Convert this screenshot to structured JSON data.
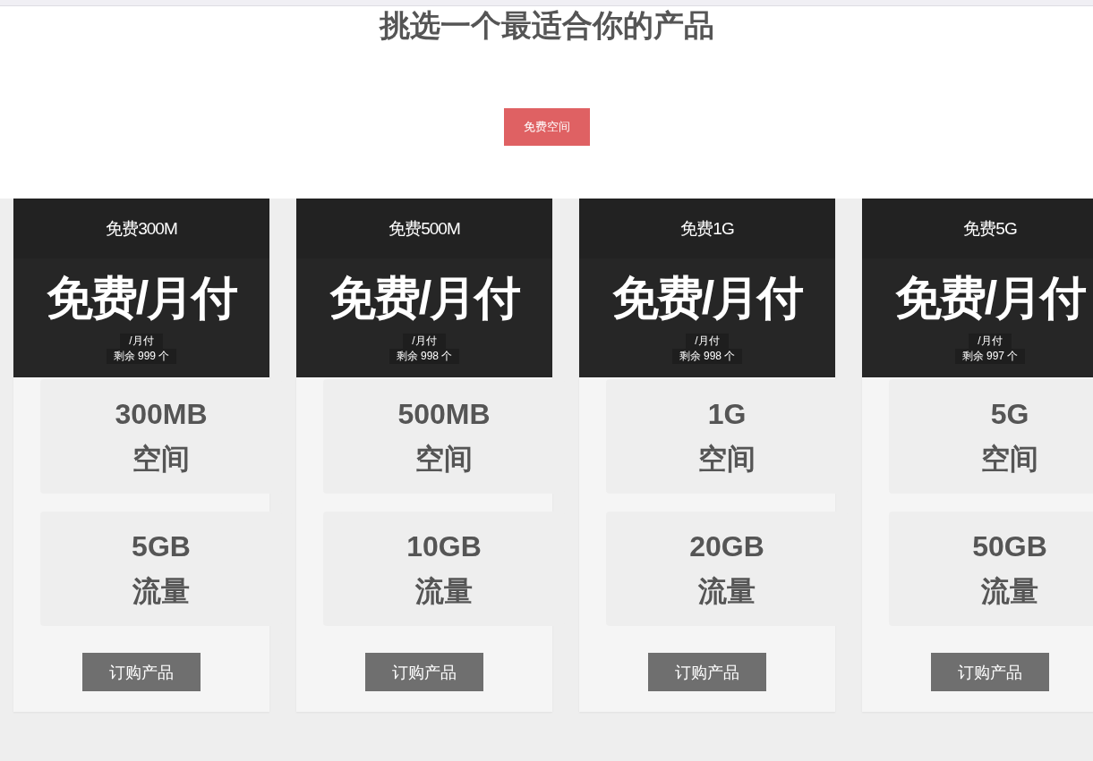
{
  "heading": "挑选一个最适合你的产品",
  "filter": {
    "label": "免费空间",
    "selected": true
  },
  "plans": [
    {
      "name": "免费300M",
      "price": "免费/月付",
      "period": "/月付",
      "stock": "剩余 999 个",
      "features": [
        {
          "value": "300MB",
          "label": "空间"
        },
        {
          "value": "5GB",
          "label": "流量"
        }
      ],
      "button": "订购产品"
    },
    {
      "name": "免费500M",
      "price": "免费/月付",
      "period": "/月付",
      "stock": "剩余 998 个",
      "features": [
        {
          "value": "500MB",
          "label": "空间"
        },
        {
          "value": "10GB",
          "label": "流量"
        }
      ],
      "button": "订购产品"
    },
    {
      "name": "免费1G",
      "price": "免费/月付",
      "period": "/月付",
      "stock": "剩余 998 个",
      "features": [
        {
          "value": "1G",
          "label": "空间"
        },
        {
          "value": "20GB",
          "label": "流量"
        }
      ],
      "button": "订购产品"
    },
    {
      "name": "免费5G",
      "price": "免费/月付",
      "period": "/月付",
      "stock": "剩余 997 个",
      "features": [
        {
          "value": "5G",
          "label": "空间"
        },
        {
          "value": "50GB",
          "label": "流量"
        }
      ],
      "button": "订购产品"
    }
  ]
}
